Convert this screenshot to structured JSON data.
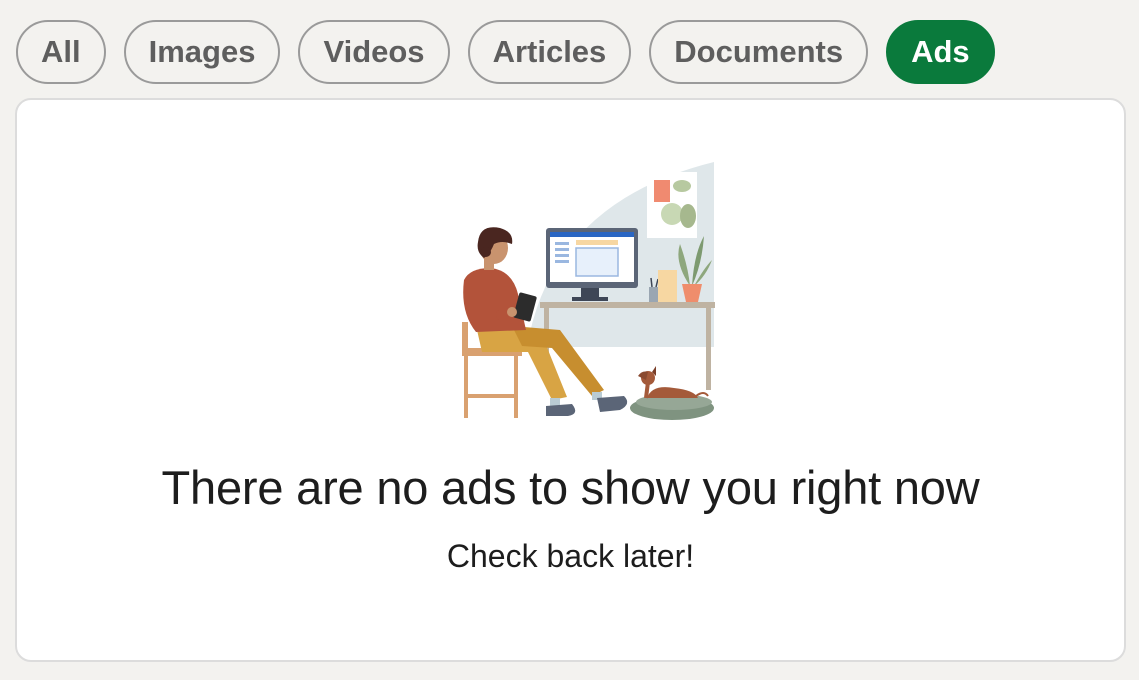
{
  "filters": {
    "all": "All",
    "images": "Images",
    "videos": "Videos",
    "articles": "Articles",
    "documents": "Documents",
    "ads": "Ads",
    "active": "Ads"
  },
  "empty_state": {
    "title": "There are no ads to show you right now",
    "subtitle": "Check back later!"
  },
  "colors": {
    "active_pill": "#0a7a3c",
    "page_background": "#f3f2ef"
  }
}
